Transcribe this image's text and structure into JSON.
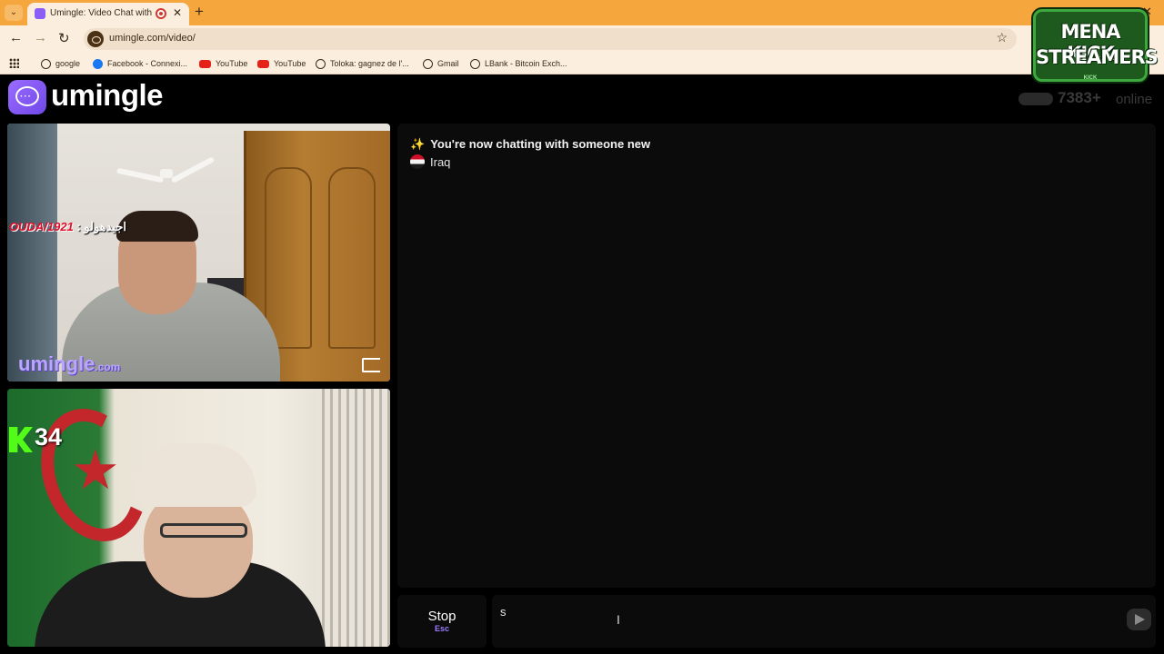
{
  "browser": {
    "tab_title": "Umingle: Video Chat with St",
    "url": "umingle.com/video/",
    "bookmarks": [
      {
        "label": "google",
        "icon": "globe-icon"
      },
      {
        "label": "Facebook - Connexi...",
        "icon": "facebook-icon"
      },
      {
        "label": "YouTube",
        "icon": "youtube-icon"
      },
      {
        "label": "YouTube",
        "icon": "youtube-icon"
      },
      {
        "label": "Toloka: gagnez de l'...",
        "icon": "globe-icon"
      },
      {
        "label": "Gmail",
        "icon": "globe-icon"
      },
      {
        "label": "LBank - Bitcoin Exch...",
        "icon": "globe-icon"
      }
    ]
  },
  "overlay": {
    "line1": "MENA KICK",
    "line2": "STREAMERS",
    "sub": "KICK"
  },
  "site": {
    "brand": "umingle",
    "online_count": "7383+",
    "online_label": "online",
    "accent": "#8b5cf6"
  },
  "stranger_video": {
    "chat_user": "OUDA/1921",
    "chat_message": ": اجيدهولو",
    "watermark": "umingle",
    "watermark_tld": ".com"
  },
  "self_video": {
    "viewer_count": "34"
  },
  "chat": {
    "status": "You're now chatting with someone new",
    "country": "Iraq",
    "input_value": "s"
  },
  "controls": {
    "stop_label": "Stop",
    "stop_key": "Esc"
  }
}
